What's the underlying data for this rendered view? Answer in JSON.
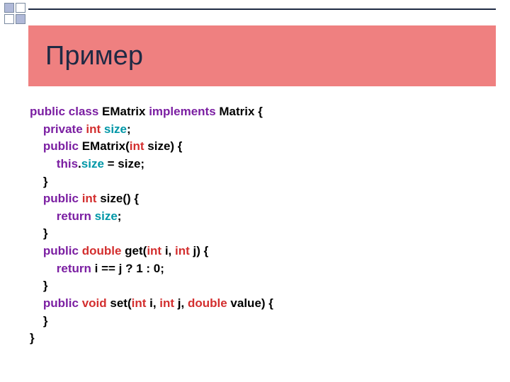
{
  "title": "Пример",
  "code": {
    "l1": {
      "kw1": "public class",
      "t1": " EMatrix ",
      "kw2": "implements",
      "t2": " Matrix {"
    },
    "l2": {
      "kw1": "private",
      "tp1": " int ",
      "mem1": "size",
      "t1": ";"
    },
    "l3": {
      "kw1": "public",
      "t1": " EMatrix(",
      "tp1": "int",
      "t2": " size) {"
    },
    "l4": {
      "kw1": "this",
      "t1": ".",
      "mem1": "size",
      "t2": " = size;"
    },
    "l5": "    }",
    "l6": {
      "kw1": "public",
      "tp1": " int ",
      "t1": "size() {"
    },
    "l7": {
      "kw1": "return",
      "mem1": " size",
      "t1": ";"
    },
    "l8": "    }",
    "l9": {
      "kw1": "public",
      "tp1": " double ",
      "t1": "get(",
      "tp2": "int",
      "t2": " i, ",
      "tp3": "int",
      "t3": " j) {"
    },
    "l10": {
      "kw1": "return",
      "t1": " i == j ? 1 : 0;"
    },
    "l11": "    }",
    "l12": {
      "kw1": "public",
      "tp1": " void ",
      "t1": "set(",
      "tp2": "int",
      "t2": " i, ",
      "tp3": "int",
      "t3": " j, ",
      "tp4": "double",
      "t4": " value) {"
    },
    "l13": "    }",
    "l14": "}"
  }
}
